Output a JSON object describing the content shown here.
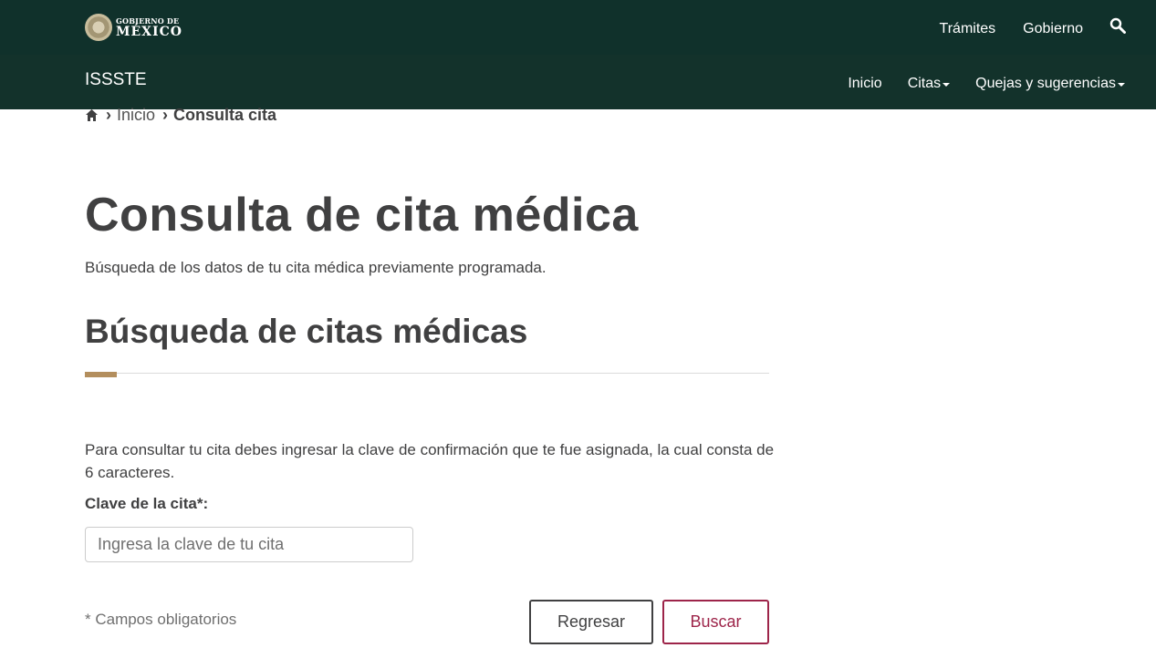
{
  "header": {
    "logo": {
      "line1": "GOBIERNO DE",
      "line2": "MÉXICO"
    },
    "links": [
      "Trámites",
      "Gobierno"
    ],
    "search_icon": "search-icon"
  },
  "subheader": {
    "site_name": "ISSSTE",
    "nav": [
      {
        "label": "Inicio",
        "dropdown": false
      },
      {
        "label": "Citas",
        "dropdown": true
      },
      {
        "label": "Quejas y sugerencias",
        "dropdown": true
      }
    ]
  },
  "breadcrumb": {
    "home_icon": "home-icon",
    "separator": "›",
    "items": [
      "Inicio",
      "Consulta cita"
    ]
  },
  "page": {
    "title": "Consulta de cita médica",
    "subtitle": "Búsqueda de los datos de tu cita médica previamente programada.",
    "section_title": "Búsqueda de citas médicas",
    "instructions": "Para consultar tu cita debes ingresar la clave de confirmación que te fue asignada, la cual consta de 6 caracteres."
  },
  "form": {
    "label": "Clave de la cita*:",
    "placeholder": "Ingresa la clave de tu cita",
    "value": "",
    "required_note": "* Campos obligatorios",
    "back_label": "Regresar",
    "search_label": "Buscar"
  },
  "colors": {
    "header_bg": "#10312b",
    "subheader_bg": "#13322b",
    "accent_gold": "#b38e5d",
    "primary_button": "#9d2449",
    "text": "#404041"
  }
}
